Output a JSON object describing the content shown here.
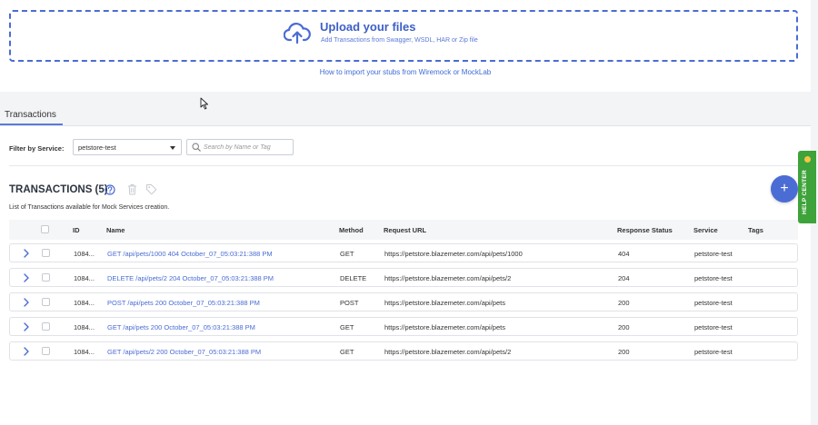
{
  "upload": {
    "title": "Upload your files",
    "subtitle": "Add Transactions from Swagger, WSDL, HAR or Zip file",
    "import_link": "How to import your stubs from Wiremock or MockLab"
  },
  "tabs": [
    {
      "label": "Transactions",
      "active": true
    }
  ],
  "filter": {
    "label": "Filter by Service:",
    "selected_service": "petstore-test",
    "search_placeholder": "Search by Name or Tag",
    "search_value": ""
  },
  "section": {
    "title": "TRANSACTIONS (5)",
    "description": "List of Transactions available for Mock Services creation."
  },
  "add_button_label": "+",
  "help_center_label": "HELP CENTER",
  "table": {
    "columns": {
      "id": "ID",
      "name": "Name",
      "method": "Method",
      "url": "Request URL",
      "status": "Response Status",
      "service": "Service",
      "tags": "Tags"
    },
    "rows": [
      {
        "id": "1084...",
        "name": "GET /api/pets/1000 404 October_07_05:03:21:388 PM",
        "method": "GET",
        "url": "https://petstore.blazemeter.com/api/pets/1000",
        "status": "404",
        "service": "petstore-test",
        "tags": ""
      },
      {
        "id": "1084...",
        "name": "DELETE /api/pets/2 204 October_07_05:03:21:388 PM",
        "method": "DELETE",
        "url": "https://petstore.blazemeter.com/api/pets/2",
        "status": "204",
        "service": "petstore-test",
        "tags": ""
      },
      {
        "id": "1084...",
        "name": "POST /api/pets 200 October_07_05:03:21:388 PM",
        "method": "POST",
        "url": "https://petstore.blazemeter.com/api/pets",
        "status": "200",
        "service": "petstore-test",
        "tags": ""
      },
      {
        "id": "1084...",
        "name": "GET /api/pets 200 October_07_05:03:21:388 PM",
        "method": "GET",
        "url": "https://petstore.blazemeter.com/api/pets",
        "status": "200",
        "service": "petstore-test",
        "tags": ""
      },
      {
        "id": "1084...",
        "name": "GET /api/pets/2 200 October_07_05:03:21:388 PM",
        "method": "GET",
        "url": "https://petstore.blazemeter.com/api/pets/2",
        "status": "200",
        "service": "petstore-test",
        "tags": ""
      }
    ]
  },
  "colors": {
    "accent": "#4a6cd4",
    "help_center": "#3ea33a"
  },
  "icons": [
    "cloud-upload-icon",
    "cursor-icon",
    "caret-down-icon",
    "search-icon",
    "help-circle-icon",
    "trash-icon",
    "tag-icon",
    "chevron-right-icon",
    "plus-icon"
  ]
}
